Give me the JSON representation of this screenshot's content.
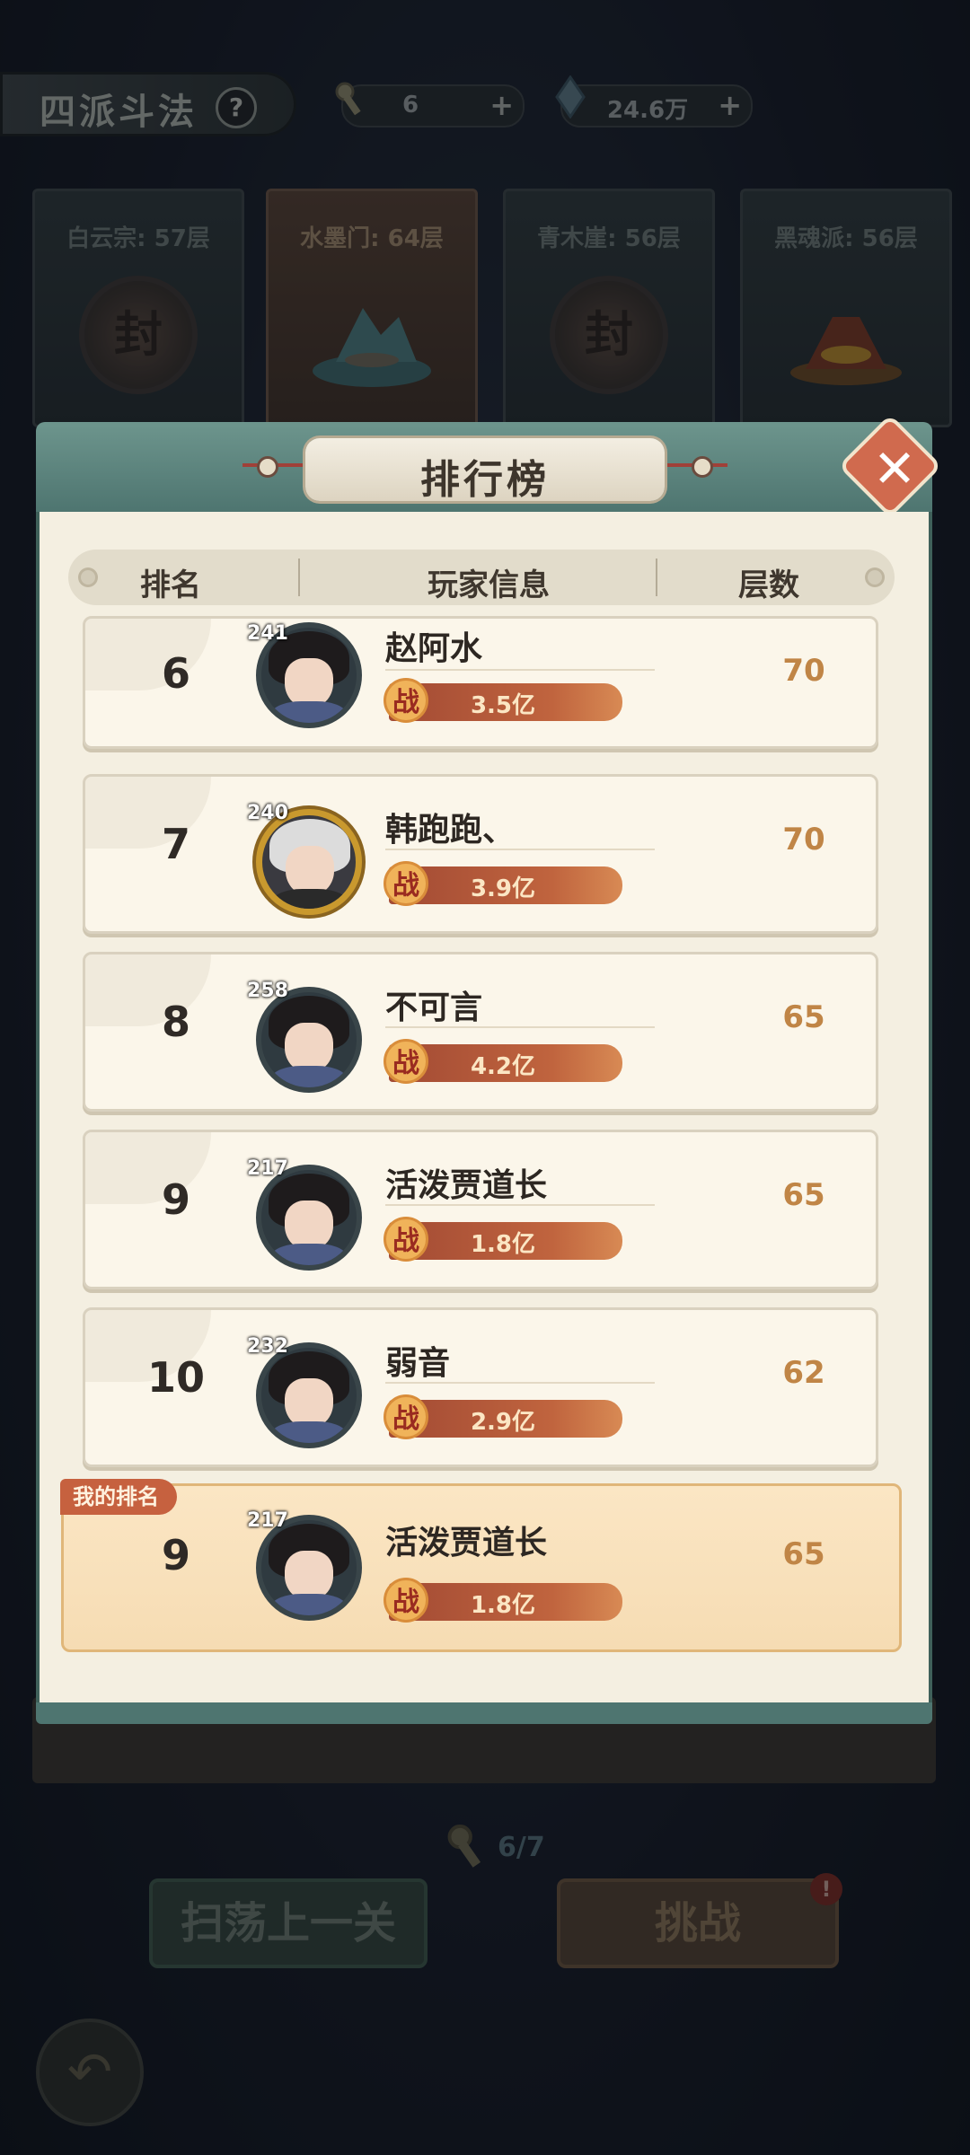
{
  "header": {
    "title": "四派斗法",
    "help_label": "?",
    "resources": [
      {
        "icon": "key-icon",
        "value": "6",
        "plus": "+"
      },
      {
        "icon": "gem-icon",
        "value": "24.6万",
        "plus": "+"
      }
    ]
  },
  "factions": [
    {
      "label": "白云宗: 57层",
      "state": "sealed",
      "seal_char": "封"
    },
    {
      "label": "水墨门: 64层",
      "state": "active"
    },
    {
      "label": "青木崖: 56层",
      "state": "sealed",
      "seal_char": "封"
    },
    {
      "label": "黑魂派: 56层",
      "state": "normal"
    }
  ],
  "modal": {
    "title": "排行榜",
    "close_label": "✕",
    "columns": {
      "rank": "排名",
      "player": "玩家信息",
      "floors": "层数"
    },
    "power_icon_char": "战",
    "rows": [
      {
        "rank": "6",
        "level": "241",
        "name": "赵阿水",
        "power": "3.5亿",
        "floors": "70",
        "avatar": "dark-hair"
      },
      {
        "rank": "7",
        "level": "240",
        "name": "韩跑跑、",
        "power": "3.9亿",
        "floors": "70",
        "avatar": "white-hair-gold-frame"
      },
      {
        "rank": "8",
        "level": "258",
        "name": "不可言",
        "power": "4.2亿",
        "floors": "65",
        "avatar": "dark-hair"
      },
      {
        "rank": "9",
        "level": "217",
        "name": "活泼贾道长",
        "power": "1.8亿",
        "floors": "65",
        "avatar": "dark-hair"
      },
      {
        "rank": "10",
        "level": "232",
        "name": "弱音",
        "power": "2.9亿",
        "floors": "62",
        "avatar": "dark-hair"
      }
    ],
    "my_rank": {
      "tag": "我的排名",
      "rank": "9",
      "level": "217",
      "name": "活泼贾道长",
      "power": "1.8亿",
      "floors": "65"
    }
  },
  "bottom": {
    "key_counter": "6/7",
    "sweep_label": "扫荡上一关",
    "challenge_label": "挑战",
    "challenge_alert": "!"
  }
}
